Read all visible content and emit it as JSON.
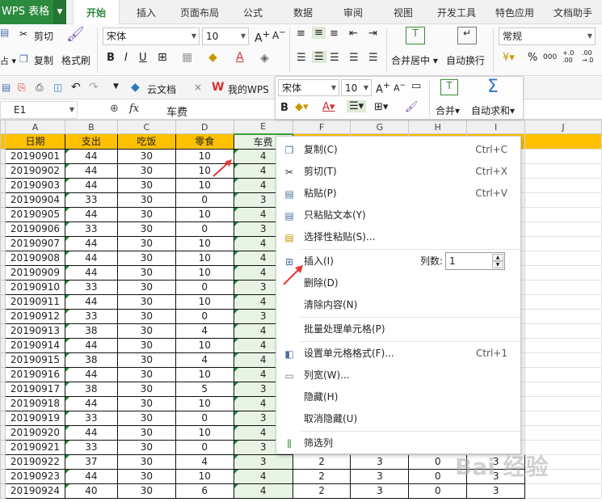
{
  "app": {
    "name": "WPS 表格"
  },
  "tabs": [
    "开始",
    "插入",
    "页面布局",
    "公式",
    "数据",
    "审阅",
    "视图",
    "开发工具",
    "特色应用",
    "文档助手"
  ],
  "active_tab": "开始",
  "ribbon": {
    "cut": "剪切",
    "copy": "复制",
    "format_painter": "格式刷",
    "font_name": "宋体",
    "font_size": "10",
    "bold": "B",
    "italic": "I",
    "underline": "U",
    "merge_center": "合并居中",
    "wrap_text": "自动换行",
    "number_format": "常规",
    "percent": "%",
    "thousands": "000",
    "left_partial": "粘贴"
  },
  "quickbar": {
    "cloud_docs": "云文档",
    "my_wps": "我的WPS"
  },
  "mini_toolbar": {
    "font_name": "宋体",
    "font_size": "10",
    "merge": "合并",
    "autosum": "自动求和"
  },
  "formula_bar": {
    "cell_ref": "E1",
    "fx": "fx",
    "value": "车费"
  },
  "columns": [
    "A",
    "B",
    "C",
    "D",
    "E",
    "F",
    "G",
    "H",
    "I",
    "J"
  ],
  "headers": [
    "日期",
    "支出",
    "吃饭",
    "零食",
    "车费"
  ],
  "rows": [
    [
      "20190901",
      "44",
      "30",
      "10",
      "4"
    ],
    [
      "20190902",
      "44",
      "30",
      "10",
      "4"
    ],
    [
      "20190903",
      "44",
      "30",
      "10",
      "4"
    ],
    [
      "20190904",
      "33",
      "30",
      "0",
      "3"
    ],
    [
      "20190905",
      "44",
      "30",
      "10",
      "4"
    ],
    [
      "20190906",
      "33",
      "30",
      "0",
      "3"
    ],
    [
      "20190907",
      "44",
      "30",
      "10",
      "4"
    ],
    [
      "20190908",
      "44",
      "30",
      "10",
      "4"
    ],
    [
      "20190909",
      "44",
      "30",
      "10",
      "4"
    ],
    [
      "20190910",
      "33",
      "30",
      "0",
      "3"
    ],
    [
      "20190911",
      "44",
      "30",
      "10",
      "4"
    ],
    [
      "20190912",
      "33",
      "30",
      "0",
      "3"
    ],
    [
      "20190913",
      "38",
      "30",
      "4",
      "4"
    ],
    [
      "20190914",
      "44",
      "30",
      "10",
      "4"
    ],
    [
      "20190915",
      "38",
      "30",
      "4",
      "4"
    ],
    [
      "20190916",
      "44",
      "30",
      "10",
      "4"
    ],
    [
      "20190917",
      "38",
      "30",
      "5",
      "3"
    ],
    [
      "20190918",
      "44",
      "30",
      "10",
      "4"
    ],
    [
      "20190919",
      "33",
      "30",
      "0",
      "3"
    ],
    [
      "20190920",
      "44",
      "30",
      "10",
      "4"
    ],
    [
      "20190921",
      "33",
      "30",
      "0",
      "3"
    ],
    [
      "20190922",
      "37",
      "30",
      "4",
      "3"
    ],
    [
      "20190923",
      "44",
      "30",
      "10",
      "4"
    ],
    [
      "20190924",
      "40",
      "30",
      "6",
      "4"
    ]
  ],
  "extra_cols": {
    "20190922": [
      "2",
      "3",
      "0",
      "3"
    ],
    "20190923": [
      "2",
      "3",
      "0",
      "3"
    ],
    "20190924": [
      "2",
      "3",
      "0",
      "3"
    ]
  },
  "context_menu": {
    "copy": {
      "label": "复制(C)",
      "shortcut": "Ctrl+C"
    },
    "cut": {
      "label": "剪切(T)",
      "shortcut": "Ctrl+X"
    },
    "paste": {
      "label": "粘贴(P)",
      "shortcut": "Ctrl+V"
    },
    "paste_text": {
      "label": "只粘贴文本(Y)"
    },
    "paste_special": {
      "label": "选择性粘贴(S)..."
    },
    "insert": {
      "label": "插入(I)",
      "count_label": "列数:",
      "count_value": "1"
    },
    "delete": {
      "label": "删除(D)"
    },
    "clear": {
      "label": "清除内容(N)"
    },
    "batch": {
      "label": "批量处理单元格(P)"
    },
    "format_cells": {
      "label": "设置单元格格式(F)...",
      "shortcut": "Ctrl+1"
    },
    "col_width": {
      "label": "列宽(W)..."
    },
    "hide": {
      "label": "隐藏(H)"
    },
    "unhide": {
      "label": "取消隐藏(U)"
    },
    "filter_col": {
      "label": "筛选列"
    }
  },
  "colors": {
    "accent": "#2b8a3e",
    "header_fill": "#ffc000",
    "selected_col": "#e7f4e4",
    "arrow": "#e53935"
  }
}
